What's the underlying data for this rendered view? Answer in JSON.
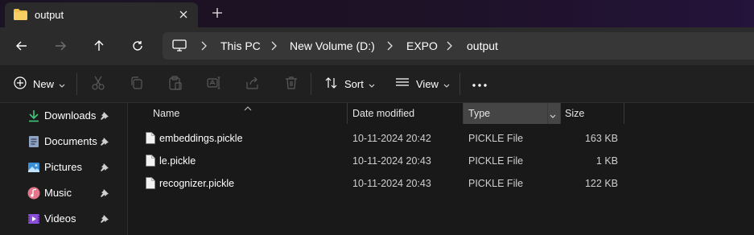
{
  "tab": {
    "title": "output",
    "close_icon": "close-icon",
    "new_tab_icon": "plus-icon"
  },
  "nav": {
    "back_icon": "arrow-left-icon",
    "forward_icon": "arrow-right-icon",
    "up_icon": "arrow-up-icon",
    "refresh_icon": "refresh-icon",
    "breadcrumbs": [
      "This PC",
      "New Volume (D:)",
      "EXPO",
      "output"
    ]
  },
  "toolbar": {
    "new_label": "New",
    "sort_label": "Sort",
    "view_label": "View",
    "icons": [
      "cut-icon",
      "copy-icon",
      "paste-icon",
      "rename-icon",
      "share-icon",
      "delete-icon",
      "more-icon"
    ]
  },
  "sidebar": {
    "items": [
      {
        "label": "Downloads",
        "icon": "download-icon"
      },
      {
        "label": "Documents",
        "icon": "document-icon"
      },
      {
        "label": "Pictures",
        "icon": "picture-icon"
      },
      {
        "label": "Music",
        "icon": "music-icon"
      },
      {
        "label": "Videos",
        "icon": "video-icon"
      }
    ]
  },
  "columns": {
    "name": "Name",
    "date": "Date modified",
    "type": "Type",
    "size": "Size"
  },
  "files": [
    {
      "name": "embeddings.pickle",
      "date": "10-11-2024 20:42",
      "type": "PICKLE File",
      "size": "163 KB"
    },
    {
      "name": "le.pickle",
      "date": "10-11-2024 20:43",
      "type": "PICKLE File",
      "size": "1 KB"
    },
    {
      "name": "recognizer.pickle",
      "date": "10-11-2024 20:43",
      "type": "PICKLE File",
      "size": "122 KB"
    }
  ],
  "colors": {
    "accent_folder": "#f2c14e",
    "background": "#191919",
    "toolbar": "#202020"
  }
}
